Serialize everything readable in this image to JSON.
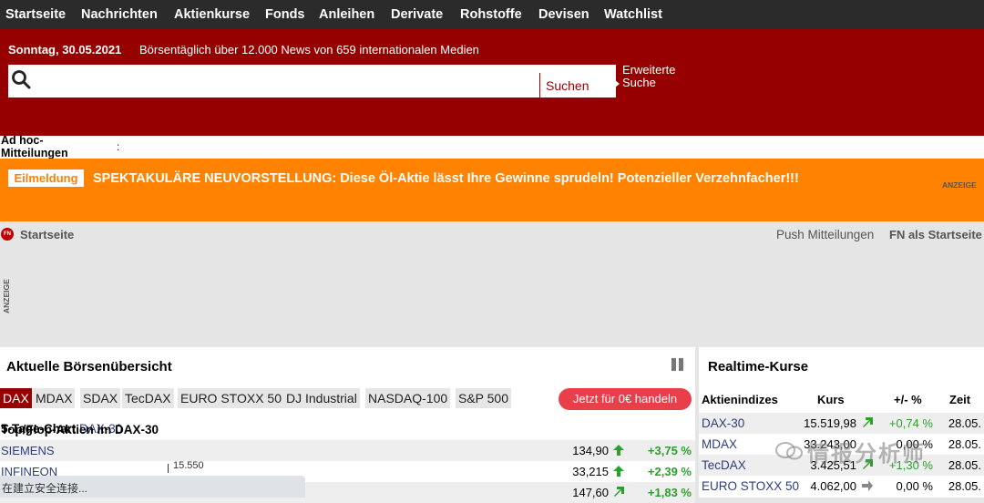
{
  "nav": {
    "items": [
      "Startseite",
      "Nachrichten",
      "Aktienkurse",
      "Fonds",
      "Anleihen",
      "Derivate",
      "Rohstoffe",
      "Devisen",
      "Watchlist"
    ]
  },
  "header": {
    "date": "Sonntag, 30.05.2021",
    "tagline": "Börsentäglich über 12.000 News von 659 internationalen Medien",
    "search_value": "",
    "search_button": "Suchen",
    "advanced_line1": "Erweiterte",
    "advanced_line2": "Suche"
  },
  "adhoc": {
    "label_line1": "Ad hoc-",
    "label_line2": "Mitteilungen",
    "separator": ":"
  },
  "breaking": {
    "badge": "Eilmeldung",
    "text": "SPEKTAKULÄRE NEUVORSTELLUNG: Diese Öl-Aktie lässt Ihre Gewinne sprudeln! Potenzieller Verzehnfacher!!!",
    "ad_label": "ANZEIGE"
  },
  "breadcrumb": {
    "home": "Startseite",
    "push": "Push Mitteilungen",
    "fn_start": "FN als Startseite",
    "side_ad": "ANZEIGE",
    "logo_text": "FN"
  },
  "overview": {
    "title": "Aktuelle Börsenübersicht",
    "tabs": [
      "DAX",
      "MDAX",
      "SDAX",
      "TecDAX",
      "EURO STOXX 50",
      "DJ Industrial",
      "NASDAQ-100",
      "S&P 500"
    ],
    "trade_button": "Jetzt für 0€ handeln",
    "sub_chart": "5-Tage-Chart",
    "sub_chart_index": "DAX-30",
    "sub_topflop": "Top/Flop-Aktien im DAX-30",
    "chart_level": "15.550",
    "rows": [
      {
        "name": "SIEMENS",
        "price": "134,90",
        "change": "+3,75 %"
      },
      {
        "name": "INFINEON",
        "price": "33,215",
        "change": "+2,39 %"
      },
      {
        "name": "",
        "price": "147,60",
        "change": "+1,83 %"
      }
    ],
    "status_text": "在建立安全连接..."
  },
  "realtime": {
    "title": "Realtime-Kurse",
    "headers": {
      "name": "Aktienindizes",
      "kurs": "Kurs",
      "change": "+/- %",
      "time": "Zeit"
    },
    "rows": [
      {
        "name": "DAX-30",
        "kurs": "15.519,98",
        "change": "+0,74 %",
        "time": "28.05."
      },
      {
        "name": "MDAX",
        "kurs": "33.243,00",
        "change": "0,00 %",
        "time": "28.05."
      },
      {
        "name": "TecDAX",
        "kurs": "3.425,51",
        "change": "+1,30 %",
        "time": "28.05."
      },
      {
        "name": "EURO STOXX 50",
        "kurs": "4.062,00",
        "change": "0,00 %",
        "time": "28.05."
      }
    ]
  },
  "watermark": "情报分析师",
  "colors": {
    "nav_bg": "#2b2b2b",
    "brand_red": "#960000",
    "breaking_orange": "#ff8200",
    "up_green": "#2e9e2e",
    "link_blue": "#2b3f7a",
    "trade_red": "#e8404a"
  }
}
